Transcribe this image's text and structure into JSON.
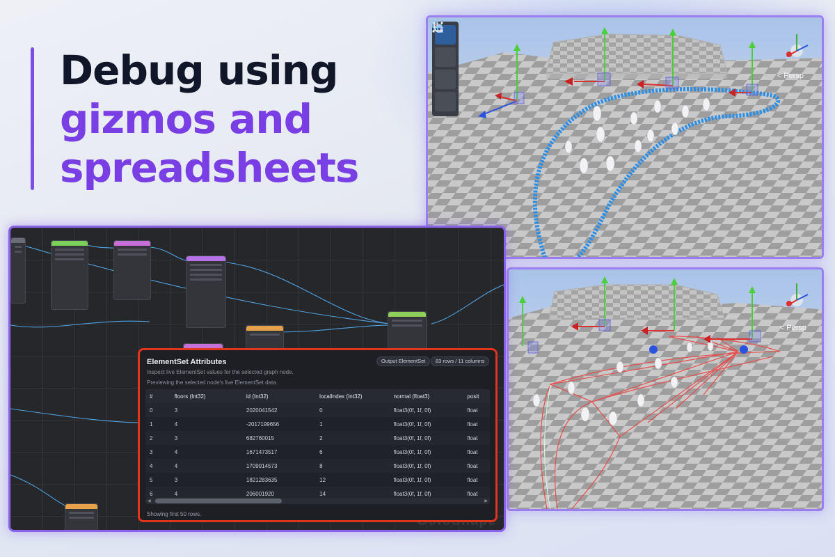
{
  "headline": {
    "line1": "Debug using",
    "line2": "gizmos and",
    "line3": "spreadsheets"
  },
  "viewport_top": {
    "view_mode": "< Persp"
  },
  "viewport_bottom": {
    "view_mode": "< Persp"
  },
  "toolbar": {
    "tools": [
      {
        "icon": "transform-nodes-icon",
        "active": true
      },
      {
        "icon": "hand-pan-icon",
        "active": false
      },
      {
        "icon": "axis-move-icon",
        "active": false
      },
      {
        "icon": "curve-edit-icon",
        "active": false
      }
    ]
  },
  "node_editor": {
    "watermark": "OctoShape"
  },
  "attributes_panel": {
    "title": "ElementSet Attributes",
    "subtitle": "Inspect live ElementSet values for the selected graph node.",
    "preview_note": "Previewing the selected node's live ElementSet data.",
    "output_badge": "Output ElementSet",
    "size_badge": "83 rows / 11 columns",
    "columns": [
      "#",
      "floors (Int32)",
      "id (Int32)",
      "localIndex (Int32)",
      "normal (float3)",
      "posit"
    ],
    "rows": [
      [
        "0",
        "3",
        "2020041542",
        "0",
        "float3(0f, 1f, 0f)",
        "float"
      ],
      [
        "1",
        "4",
        "-2017199656",
        "1",
        "float3(0f, 1f, 0f)",
        "float"
      ],
      [
        "2",
        "3",
        "682760015",
        "2",
        "float3(0f, 1f, 0f)",
        "float"
      ],
      [
        "3",
        "4",
        "1671473517",
        "6",
        "float3(0f, 1f, 0f)",
        "float"
      ],
      [
        "4",
        "4",
        "1709914573",
        "8",
        "float3(0f, 1f, 0f)",
        "float"
      ],
      [
        "5",
        "3",
        "1821283635",
        "12",
        "float3(0f, 1f, 0f)",
        "float"
      ],
      [
        "6",
        "4",
        "206001920",
        "14",
        "float3(0f, 1f, 0f)",
        "float"
      ]
    ],
    "footer": "Showing first 50 rows."
  },
  "colors": {
    "accent_purple": "#7a3fe4",
    "panel_border_red": "#e0341c",
    "spline_blue": "#2b8fe8",
    "debug_red": "#e84a4a"
  }
}
